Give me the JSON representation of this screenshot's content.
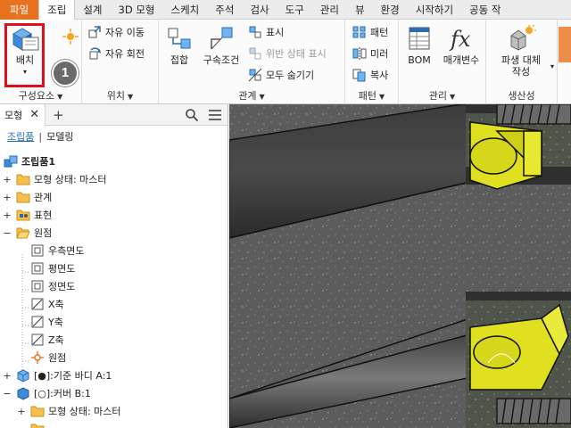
{
  "menu_tabs": [
    {
      "label": "파일"
    },
    {
      "label": "조립"
    },
    {
      "label": "설계"
    },
    {
      "label": "3D 모형"
    },
    {
      "label": "스케치"
    },
    {
      "label": "주석"
    },
    {
      "label": "검사"
    },
    {
      "label": "도구"
    },
    {
      "label": "관리"
    },
    {
      "label": "뷰"
    },
    {
      "label": "환경"
    },
    {
      "label": "시작하기"
    },
    {
      "label": "공동 작"
    }
  ],
  "ribbon": {
    "place_label": "배치",
    "callout_number": "1",
    "free_move": "자유 이동",
    "free_rotate": "자유 회전",
    "component_panel": "구성요소",
    "position_panel": "위치",
    "join_label": "접합",
    "constrain_label": "구속조건",
    "show_label": "표시",
    "violation_label": "위반 상태 표시",
    "hide_all_label": "모두 숨기기",
    "relations_panel": "관계",
    "pattern_label": "패턴",
    "mirror_label": "미러",
    "copy_label": "복사",
    "pattern_panel": "패턴",
    "bom_label": "BOM",
    "params_label": "매개변수",
    "manage_panel": "관리",
    "derive_line1": "파생 대체",
    "derive_line2": "작성",
    "productivity_panel": "생산성",
    "colors": {
      "file_tab": "#e8731e",
      "highlight": "#e0101a"
    }
  },
  "browser": {
    "tab_label": "모형",
    "subtab_assembly": "조립품",
    "subtab_modeling": "모델링",
    "tree": [
      {
        "label": "조립품1"
      },
      {
        "label": "모형 상태: 마스터"
      },
      {
        "label": "관계"
      },
      {
        "label": "표현"
      },
      {
        "label": "원점"
      },
      {
        "label": "우측면도"
      },
      {
        "label": "평면도"
      },
      {
        "label": "정면도"
      },
      {
        "label": "X축"
      },
      {
        "label": "Y축"
      },
      {
        "label": "Z축"
      },
      {
        "label": "원점"
      },
      {
        "label": "[●]:기준 바디 A:1"
      },
      {
        "label": "[○]:커버 B:1"
      },
      {
        "label": "모형 상태: 마스터"
      }
    ]
  }
}
